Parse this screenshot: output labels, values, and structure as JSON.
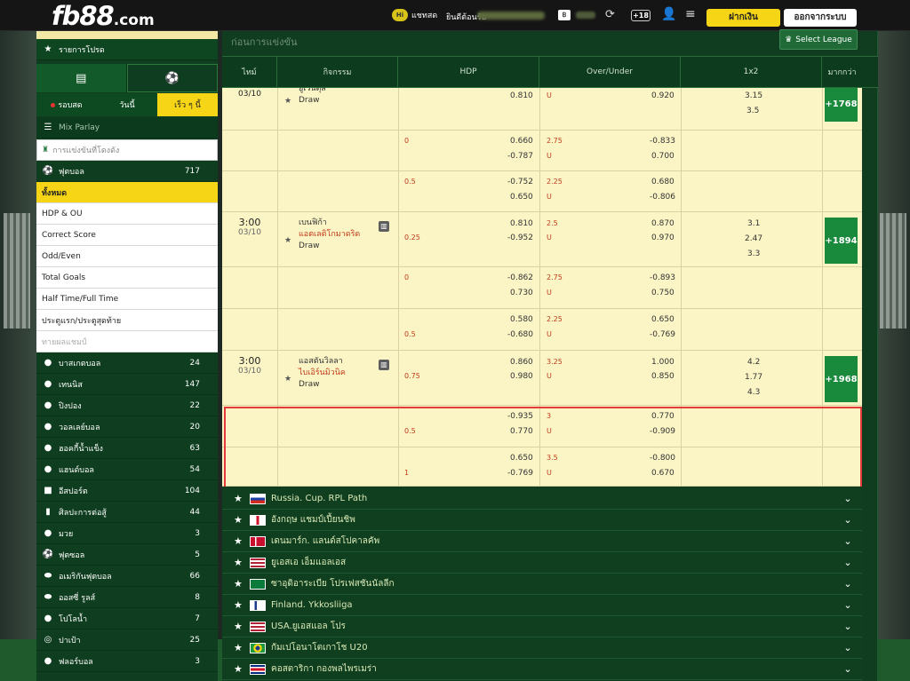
{
  "header": {
    "logo_main": "fb88",
    "logo_domain": ".com",
    "chat_label": "แชทสด",
    "welcome_label": "ยินดีต้อนรับ",
    "deposit_label": "ฝากเงิน",
    "logout_label": "ออกจากระบบ",
    "promo_label": "+18"
  },
  "sidebar": {
    "favorites_label": "รายการโปรด",
    "tabs": [
      {
        "label": "รอบสด"
      },
      {
        "label": "วันนี้"
      },
      {
        "label": "เร็ว ๆ นี้"
      }
    ],
    "mix_parlay_label": "Mix Parlay",
    "search_placeholder": "การแข่งขันที่โดงดัง",
    "soccer": {
      "label": "ฟุตบอล",
      "count": "717"
    },
    "bet_types": [
      {
        "label": "ทั้งหมด"
      },
      {
        "label": "HDP & OU"
      },
      {
        "label": "Correct Score"
      },
      {
        "label": "Odd/Even"
      },
      {
        "label": "Total Goals"
      },
      {
        "label": "Half Time/Full Time"
      },
      {
        "label": "ประตูแรก/ประตูสุดท้าย"
      },
      {
        "label": "ทายผลแชมป์"
      }
    ],
    "sports": [
      {
        "label": "บาสเกตบอล",
        "count": "24"
      },
      {
        "label": "เทนนิส",
        "count": "147"
      },
      {
        "label": "ปิงปอง",
        "count": "22"
      },
      {
        "label": "วอลเลย์บอล",
        "count": "20"
      },
      {
        "label": "ฮอคกี้น้ำแข็ง",
        "count": "63"
      },
      {
        "label": "แฮนด์บอล",
        "count": "54"
      },
      {
        "label": "อีสปอร์ต",
        "count": "104"
      },
      {
        "label": "ศิลปะการต่อสู้",
        "count": "44"
      },
      {
        "label": "มวย",
        "count": "3"
      },
      {
        "label": "ฟุตซอล",
        "count": "5"
      },
      {
        "label": "อเมริกันฟุตบอล",
        "count": "66"
      },
      {
        "label": "ออสซี่ รูลส์",
        "count": "8"
      },
      {
        "label": "โปโลน้ำ",
        "count": "7"
      },
      {
        "label": "ปาเป้า",
        "count": "25"
      },
      {
        "label": "ฟลอร์บอล",
        "count": "3"
      }
    ]
  },
  "main": {
    "section_label": "ก่อนการแข่งขัน",
    "select_league_label": "Select League",
    "columns": {
      "time": "ไทม์",
      "event": "กิจกรรม",
      "hdp": "HDP",
      "ou": "Over/Under",
      "x12": "1x2",
      "more": "มากกว่า"
    },
    "matches": [
      {
        "date": "03/10",
        "home": "ยูเวนตุส",
        "draw": "Draw",
        "more": "+1768",
        "lines": [
          {
            "hdp_home": "0.810",
            "ou_u": "0.920",
            "x1": "3.15",
            "x2": "3.5"
          },
          {
            "hdp_line": "0",
            "hdp_home": "0.660",
            "hdp_away": "-0.787",
            "ou_line": "2.75",
            "ou_o": "-0.833",
            "ou_u": "0.700"
          },
          {
            "hdp_line": "0.5",
            "hdp_home": "-0.752",
            "hdp_away": "0.650",
            "ou_line": "2.25",
            "ou_o": "0.680",
            "ou_u": "-0.806"
          }
        ]
      },
      {
        "time": "3:00",
        "date": "03/10",
        "home": "เบนฟิก้า",
        "away": "แอตเลติโกมาดริด",
        "draw": "Draw",
        "more": "+1894",
        "lines": [
          {
            "hdp_line": "0.25",
            "hdp_home": "0.810",
            "hdp_away": "-0.952",
            "ou_line": "2.5",
            "ou_o": "0.870",
            "ou_u": "0.970",
            "x1": "3.1",
            "x2": "2.47",
            "x3": "3.3"
          },
          {
            "hdp_line": "0",
            "hdp_home": "-0.862",
            "hdp_away": "0.730",
            "ou_line": "2.75",
            "ou_o": "-0.893",
            "ou_u": "0.750"
          },
          {
            "hdp_line": "0.5",
            "hdp_home": "0.580",
            "hdp_away": "-0.680",
            "ou_line": "2.25",
            "ou_o": "0.650",
            "ou_u": "-0.769"
          }
        ]
      },
      {
        "time": "3:00",
        "date": "03/10",
        "home": "แอสตันวิลลา",
        "away": "ไบเอิร์นมิวนิค",
        "draw": "Draw",
        "more": "+1968",
        "lines": [
          {
            "hdp_line": "0.75",
            "hdp_home": "0.860",
            "hdp_away": "0.980",
            "ou_line": "3.25",
            "ou_o": "1.000",
            "ou_u": "0.850",
            "x1": "4.2",
            "x2": "1.77",
            "x3": "4.3"
          },
          {
            "hdp_line": "0.5",
            "hdp_home": "-0.935",
            "hdp_away": "0.770",
            "ou_line": "3",
            "ou_o": "0.770",
            "ou_u": "-0.909"
          },
          {
            "hdp_line": "1",
            "hdp_home": "0.650",
            "hdp_away": "-0.769",
            "ou_line": "3.5",
            "ou_o": "-0.800",
            "ou_u": "0.670"
          }
        ]
      }
    ],
    "under_label": "U",
    "leagues": [
      {
        "name": "Russia. Cup. RPL Path",
        "flag": "ru"
      },
      {
        "name": "อังกฤษ แชมป์เปี้ยนชิพ",
        "flag": "en"
      },
      {
        "name": "เดนมาร์ก. แลนด์สโปคาลคัพ",
        "flag": "dk"
      },
      {
        "name": "ยูเอสเอ เอ็มแอลเอส",
        "flag": "us"
      },
      {
        "name": "ซาอุดิอาระเบีย โปรเฟสชันนัลลีก",
        "flag": "sa"
      },
      {
        "name": "Finland. Ykkosliiga",
        "flag": "fi"
      },
      {
        "name": "USA.ยูเอสแอล โปร",
        "flag": "us"
      },
      {
        "name": "กัมเปโอนาโตเกาโช U20",
        "flag": "br"
      },
      {
        "name": "คอสตาริกา กองพลไพรเมร่า",
        "flag": "cr"
      }
    ]
  }
}
